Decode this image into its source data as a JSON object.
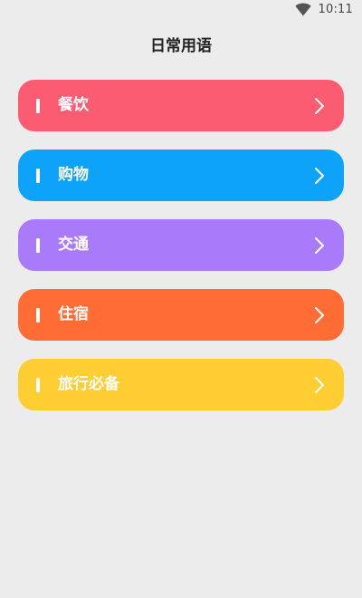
{
  "status_bar": {
    "time": "10:11",
    "wifi_icon": "wifi-icon"
  },
  "header": {
    "title": "日常用语"
  },
  "categories": [
    {
      "label": "餐饮",
      "color": "#fc5c72",
      "icon": "chevron-right-icon"
    },
    {
      "label": "购物",
      "color": "#0da3fb",
      "icon": "chevron-right-icon"
    },
    {
      "label": "交通",
      "color": "#a97bfa",
      "icon": "chevron-right-icon"
    },
    {
      "label": "住宿",
      "color": "#ff6d35",
      "icon": "chevron-right-icon"
    },
    {
      "label": "旅行必备",
      "color": "#ffce32",
      "icon": "chevron-right-icon"
    }
  ],
  "colors": {
    "background": "#ececec",
    "title_text": "#222222",
    "item_text": "#ffffff"
  }
}
